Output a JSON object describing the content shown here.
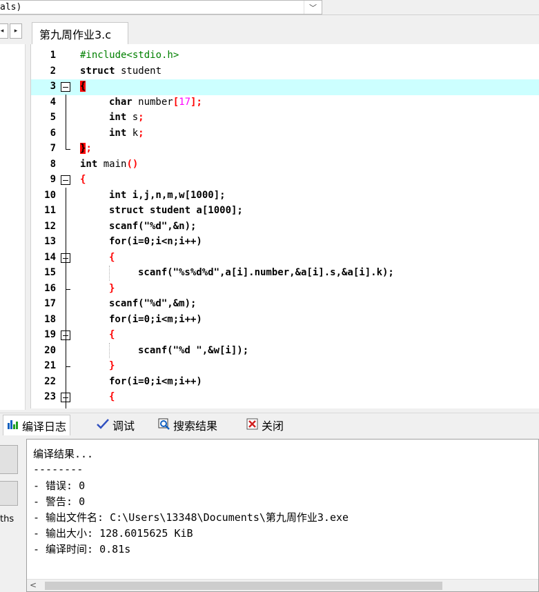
{
  "combo": {
    "text": "als)",
    "arrow": "﹀"
  },
  "tabs": {
    "nav_left": "◂",
    "nav_right": "▸",
    "file_tab": "第九周作业3.c"
  },
  "editor": {
    "lines": [
      {
        "n": "1"
      },
      {
        "n": "2"
      },
      {
        "n": "3"
      },
      {
        "n": "4"
      },
      {
        "n": "5"
      },
      {
        "n": "6"
      },
      {
        "n": "7"
      },
      {
        "n": "8"
      },
      {
        "n": "9"
      },
      {
        "n": "10"
      },
      {
        "n": "11"
      },
      {
        "n": "12"
      },
      {
        "n": "13"
      },
      {
        "n": "14"
      },
      {
        "n": "15"
      },
      {
        "n": "16"
      },
      {
        "n": "17"
      },
      {
        "n": "18"
      },
      {
        "n": "19"
      },
      {
        "n": "20"
      },
      {
        "n": "21"
      },
      {
        "n": "22"
      },
      {
        "n": "23"
      }
    ],
    "code": {
      "l1": "#include<stdio.h>",
      "l2a": "struct",
      "l2b": " student",
      "l3": "{",
      "l4a": "char",
      "l4b": " number",
      "l4c": "[",
      "l4d": "17",
      "l4e": "];",
      "l5a": "int",
      "l5b": " s",
      "l5c": ";",
      "l6a": "int",
      "l6b": " k",
      "l6c": ";",
      "l7a": "}",
      "l7b": ";",
      "l8a": "int",
      "l8b": " main",
      "l8c": "()",
      "l9": "{",
      "l10": "int i,j,n,m,w[1000];",
      "l11": "struct student a[1000];",
      "l12": "scanf(\"%d\",&n);",
      "l13": "for(i=0;i<n;i++)",
      "l14": "{",
      "l15": "scanf(\"%s%d%d\",a[i].number,&a[i].s,&a[i].k);",
      "l16": "}",
      "l17": "scanf(\"%d\",&m);",
      "l18": "for(i=0;i<m;i++)",
      "l19": "{",
      "l20": "scanf(\"%d \",&w[i]);",
      "l21": "}",
      "l22": "for(i=0;i<m;i++)",
      "l23": "{"
    }
  },
  "bottom_tabs": [
    {
      "label": "编译日志",
      "icon": "chart-icon"
    },
    {
      "label": "调试",
      "icon": "check-icon"
    },
    {
      "label": "搜索结果",
      "icon": "search-icon"
    },
    {
      "label": "关闭",
      "icon": "close-icon"
    }
  ],
  "side_label": "ths",
  "output": {
    "lines": [
      "编译结果...",
      "--------",
      "- 错误: 0",
      "- 警告: 0",
      "- 输出文件名: C:\\Users\\13348\\Documents\\第九周作业3.exe",
      "- 输出大小: 128.6015625 KiB",
      "- 编译时间: 0.81s"
    ],
    "scroll_left": "<"
  }
}
